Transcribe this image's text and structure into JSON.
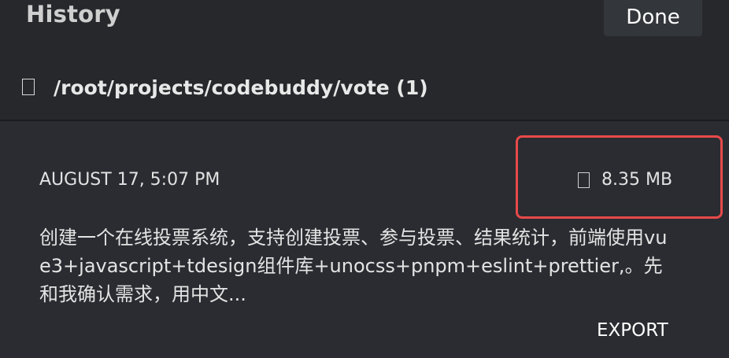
{
  "header": {
    "title": "History",
    "done_label": "Done"
  },
  "workspace": {
    "icon": "folder-icon",
    "path": "/root/projects/codebuddy/vote (1)"
  },
  "entry": {
    "date": "AUGUST 17, 5:07 PM",
    "size_icon": "file-icon",
    "size": "8.35 MB",
    "description": "创建一个在线投票系统，支持创建投票、参与投票、结果统计，前端使用vue3+javascript+tdesign组件库+unocss+pnpm+eslint+prettier,。先和我确认需求，用中文...",
    "export_label": "EXPORT",
    "highlight_color": "#e8494a"
  },
  "colors": {
    "background": "#26282c",
    "card": "#2a2c31",
    "button": "#33363b"
  }
}
